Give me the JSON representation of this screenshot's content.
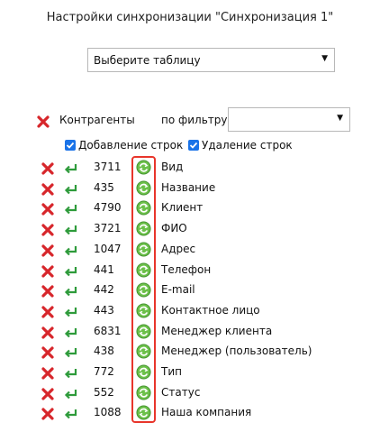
{
  "title": "Настройки синхронизации \"Синхронизация 1\"",
  "table_select": {
    "value": "Выберите таблицу"
  },
  "header": {
    "name": "Контрагенты",
    "filter_label": "по фильтру",
    "filter_value": ""
  },
  "options": {
    "add_rows": "Добавление строк",
    "delete_rows": "Удаление строк"
  },
  "fields": [
    {
      "num": "3711",
      "label": "Вид"
    },
    {
      "num": "435",
      "label": "Название"
    },
    {
      "num": "4790",
      "label": "Клиент"
    },
    {
      "num": "3721",
      "label": "ФИО"
    },
    {
      "num": "1047",
      "label": "Адрес"
    },
    {
      "num": "441",
      "label": "Телефон"
    },
    {
      "num": "442",
      "label": "E-mail"
    },
    {
      "num": "443",
      "label": "Контактное лицо"
    },
    {
      "num": "6831",
      "label": "Менеджер клиента"
    },
    {
      "num": "438",
      "label": "Менеджер (пользователь)"
    },
    {
      "num": "772",
      "label": "Тип"
    },
    {
      "num": "552",
      "label": "Статус"
    },
    {
      "num": "1088",
      "label": "Наша компания"
    }
  ],
  "colors": {
    "delete_icon": "#d7262b",
    "enter_icon": "#2e9b3b",
    "sync_icon": "#6cc04a",
    "checkbox": "#1a73e8",
    "highlight": "#e8352b"
  },
  "icons": {
    "delete": "delete-x-icon",
    "enter": "enter-arrow-icon",
    "sync": "sync-icon"
  }
}
